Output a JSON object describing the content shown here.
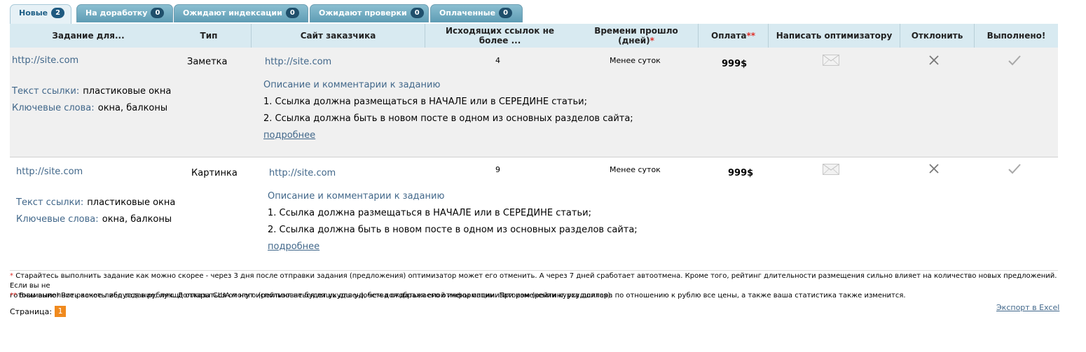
{
  "tabs": [
    {
      "label": "Новые",
      "count": "2",
      "active": true
    },
    {
      "label": "На доработку",
      "count": "0"
    },
    {
      "label": "Ожидают индексации",
      "count": "0"
    },
    {
      "label": "Ожидают проверки",
      "count": "0"
    },
    {
      "label": "Оплаченные",
      "count": "0"
    }
  ],
  "table": {
    "headers": {
      "task": "Задание для...",
      "type": "Тип",
      "site": "Сайт заказчика",
      "links": "Исходящих ссылок не более ...",
      "time": "Времени прошло (дней)",
      "time_mark": "*",
      "pay": "Оплата",
      "pay_mark": "**",
      "write": "Написать оптимизатору",
      "reject": "Отклонить",
      "done": "Выполнено!"
    },
    "rows": [
      {
        "task_url": "http://site.com",
        "link_text_label": "Текст ссылки:",
        "link_text": "пластиковые окна",
        "keywords_label": "Ключевые слова:",
        "keywords": "окна, балконы",
        "type": "Заметка",
        "site_url": "http://site.com",
        "desc_title": "Описание и комментарии к заданию",
        "desc_1": "1. Ссылка должна размещаться в НАЧАЛЕ или в СЕРЕДИНЕ статьи;",
        "desc_2": "2. Ссылка должна быть в новом посте в одном из основных разделов сайта;",
        "more": "подробнее",
        "links": "4",
        "time": "Менее суток",
        "pay": "999$"
      },
      {
        "task_url": "http://site.com",
        "link_text_label": "Текст ссылки:",
        "link_text": "пластиковые окна",
        "keywords_label": "Ключевые слова:",
        "keywords": "окна, балконы",
        "type": "Картинка",
        "site_url": "http://site.com",
        "desc_title": "Описание и комментарии к заданию",
        "desc_1": "1. Ссылка должна размещаться в НАЧАЛЕ или в СЕРЕДИНЕ статьи;",
        "desc_2": "2. Ссылка должна быть в новом посте в одном из основных разделов сайта;",
        "more": "подробнее",
        "links": "9",
        "time": "Менее суток",
        "pay": "999$"
      }
    ]
  },
  "footer": {
    "note1_mark": "*",
    "note1_line1": "Старайтесь выполнить задание как можно скорее - через 3 дня после отправки задания (предложения) оптимизатор может его отменить. А через 7 дней сработает автоотмена. Кроме того, рейтинг длительности размещения сильно влияет на количество новых предложений. Если вы не",
    "note1_line2": "готовы выполнить какое-либо задание, лучше отказаться от него (рейтинг не будет ухудшен), чем дождаться его отмены оптимизатором (рейтинг ухудшится).",
    "note2_mark": "**",
    "note2": "Внимание! Все расчеты ведутся в рублях. Доллары США могут использоваться лишь для удобства отображаемой информации. При изменении курса доллара по отношению к рублю все цены, а также ваша статистика также изменится.",
    "page_label": "Страница:",
    "page_current": "1",
    "export": "Экспорт в Excel"
  },
  "icons": {
    "write": "envelope-icon",
    "reject": "close-icon",
    "done": "checkmark-icon"
  },
  "colors": {
    "tab": "#5e9cb4",
    "header_bg": "#d8eaf1",
    "link": "#41678a",
    "required": "#e0302a",
    "page_button": "#f08a1e"
  }
}
